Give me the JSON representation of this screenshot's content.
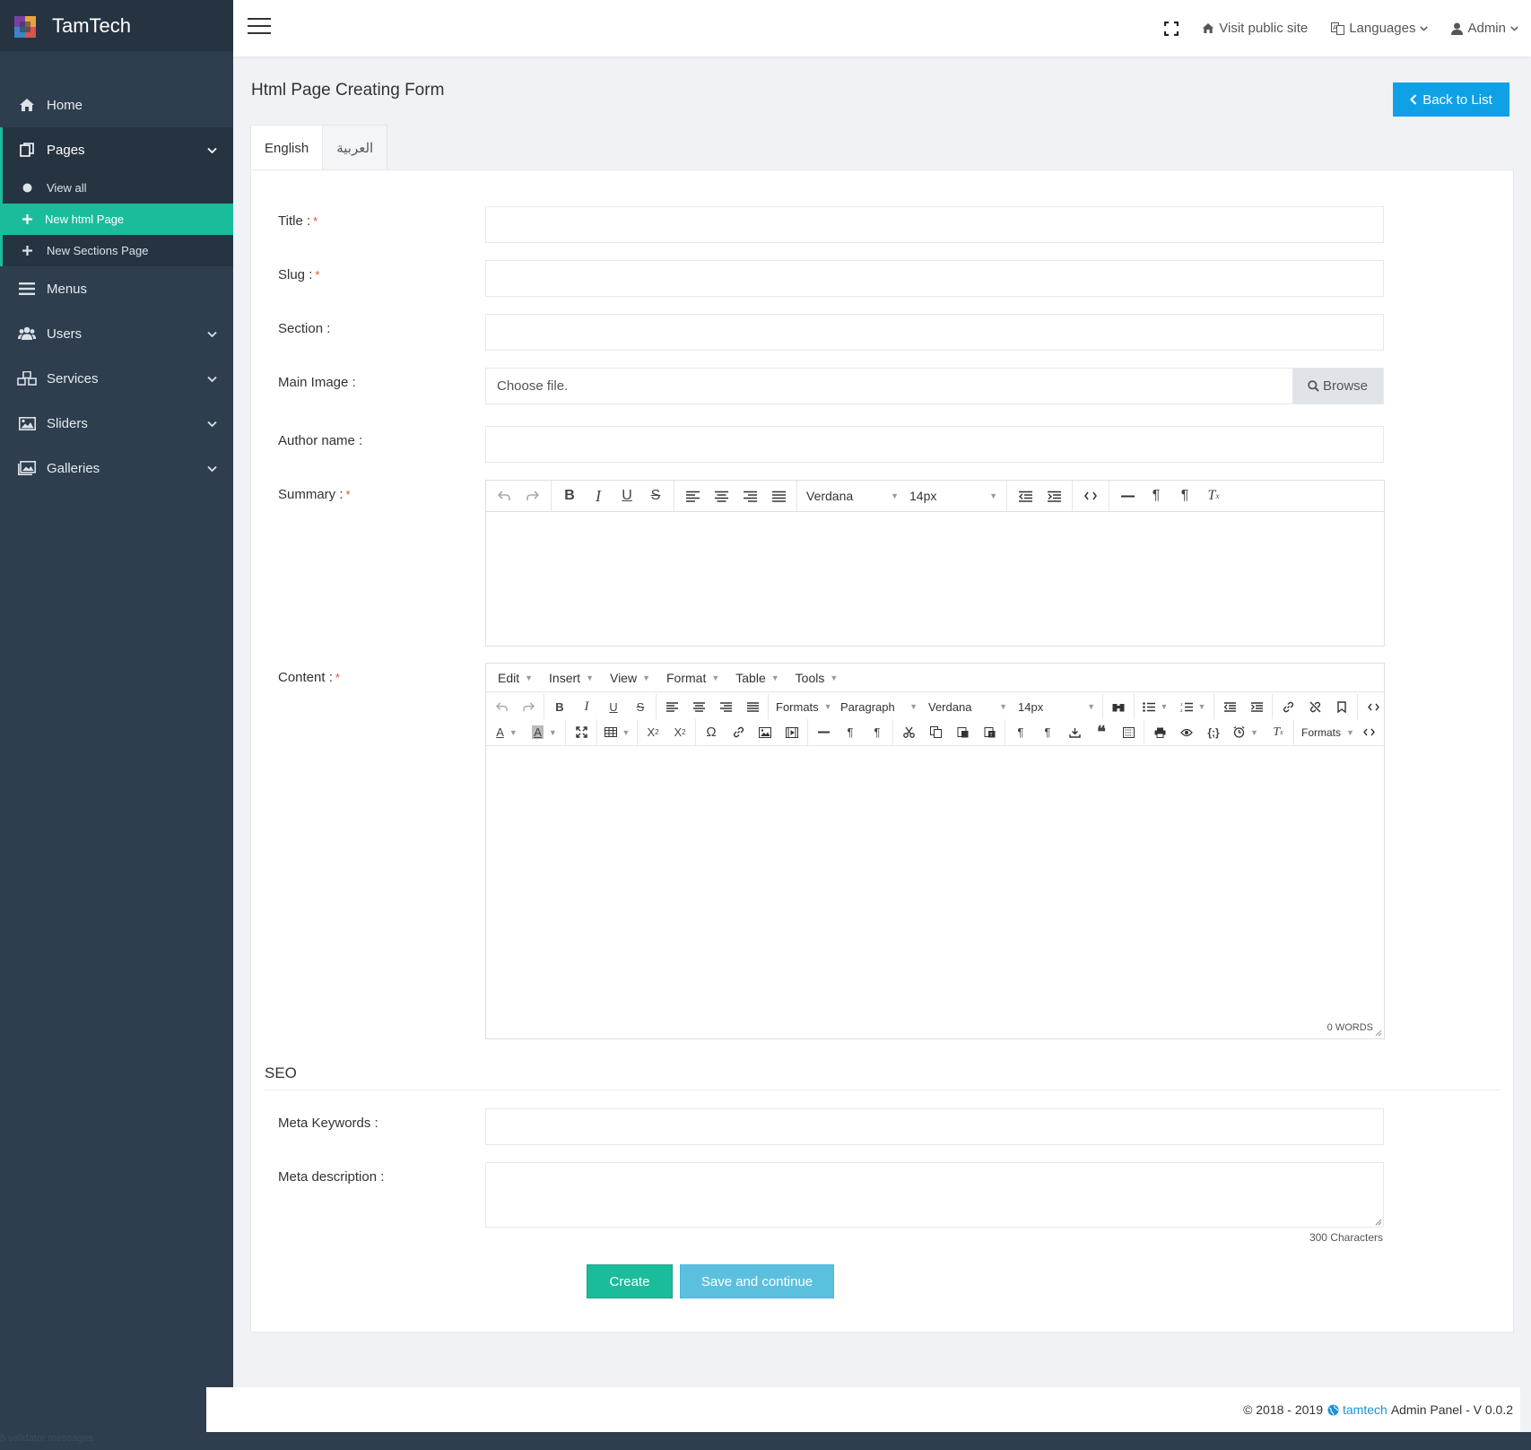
{
  "brand": {
    "name": "TamTech"
  },
  "sidebar": {
    "items": [
      {
        "label": "Home",
        "icon": "home-icon"
      },
      {
        "label": "Pages",
        "icon": "pages-icon"
      },
      {
        "label": "Menus",
        "icon": "menu-icon"
      },
      {
        "label": "Users",
        "icon": "users-icon"
      },
      {
        "label": "Services",
        "icon": "cubes-icon"
      },
      {
        "label": "Sliders",
        "icon": "image-icon"
      },
      {
        "label": "Galleries",
        "icon": "gallery-icon"
      }
    ],
    "pages_sub": [
      {
        "label": "View all"
      },
      {
        "label": "New html Page"
      },
      {
        "label": "New Sections Page"
      }
    ]
  },
  "topbar": {
    "visit": "Visit public site",
    "languages": "Languages",
    "user": "Admin"
  },
  "main": {
    "title": "Html Page Creating Form",
    "back": "Back to List",
    "tabs": [
      "English",
      "العربية"
    ]
  },
  "form": {
    "title_label": "Title :",
    "slug_label": "Slug :",
    "section_label": "Section :",
    "main_image_label": "Main Image :",
    "file_placeholder": "Choose file.",
    "browse": "Browse",
    "author_label": "Author name :",
    "summary_label": "Summary :",
    "content_label": "Content :",
    "required_mark": "*"
  },
  "summary_editor": {
    "font": "Verdana",
    "size": "14px"
  },
  "content_editor": {
    "menus": [
      "Edit",
      "Insert",
      "View",
      "Format",
      "Table",
      "Tools"
    ],
    "formats": "Formats",
    "block": "Paragraph",
    "font": "Verdana",
    "size": "14px",
    "formats2": "Formats",
    "words": "0 WORDS"
  },
  "seo": {
    "title": "SEO",
    "keywords_label": "Meta Keywords :",
    "description_label": "Meta description :",
    "chars": "300 Characters"
  },
  "actions": {
    "create": "Create",
    "save_continue": "Save and continue"
  },
  "footer": {
    "prefix": "© 2018 - 2019",
    "link": "tamtech",
    "suffix": "Admin Panel - V 0.0.2"
  },
  "bottom": {
    "text": "5 validator messages"
  },
  "colors": {
    "accent": "#1abc9c",
    "primary": "#0ea1e6",
    "sidebar": "#2e3e4e"
  }
}
